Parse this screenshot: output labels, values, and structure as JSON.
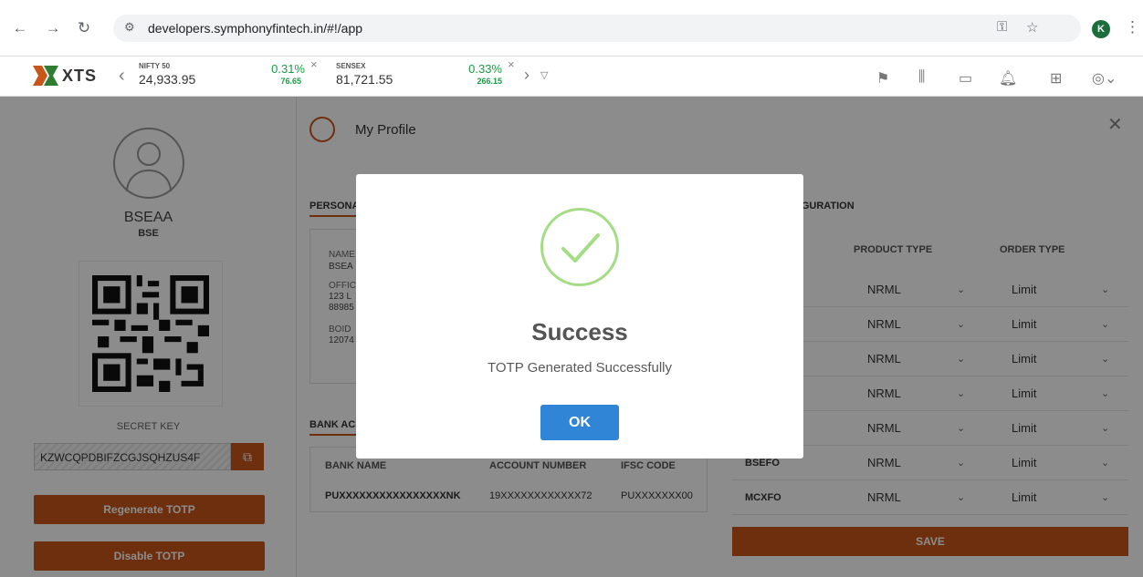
{
  "browser": {
    "url": "developers.symphonyfintech.in/#!/app",
    "profile_initial": "K"
  },
  "header": {
    "logo_text": "XTS",
    "indices": [
      {
        "name": "NIFTY 50",
        "value": "24,933.95",
        "pct": "0.31%",
        "change": "76.65"
      },
      {
        "name": "SENSEX",
        "value": "81,721.55",
        "pct": "0.33%",
        "change": "266.15"
      }
    ]
  },
  "left": {
    "user_name": "BSEAA",
    "user_sub": "BSE",
    "secret_label": "SECRET KEY",
    "secret_value": "KZWCQPDBIFZCGJSQHZUS4F",
    "regen_label": "Regenerate TOTP",
    "disable_label": "Disable TOTP"
  },
  "profile": {
    "title": "My Profile",
    "personal_tab": "PERSONA",
    "config_tab": "IFIGURATION",
    "personal_fields": [
      {
        "label": "NAME",
        "value": "BSEA"
      },
      {
        "label": "OFFIC",
        "value": "123 L"
      },
      {
        "label": "",
        "value": "88985"
      },
      {
        "label": "BOID",
        "value": "12074"
      }
    ],
    "bank_tab": "BANK AC",
    "bank_headers": [
      "BANK NAME",
      "ACCOUNT NUMBER",
      "IFSC CODE"
    ],
    "bank_row": [
      "PUXXXXXXXXXXXXXXXXNK",
      "19XXXXXXXXXXXX72",
      "PUXXXXXXX00"
    ],
    "config_headers": [
      "PRODUCT TYPE",
      "ORDER TYPE"
    ],
    "config_rows": [
      {
        "segment": "",
        "product": "NRML",
        "order": "Limit"
      },
      {
        "segment": "",
        "product": "NRML",
        "order": "Limit"
      },
      {
        "segment": "",
        "product": "NRML",
        "order": "Limit"
      },
      {
        "segment": "",
        "product": "NRML",
        "order": "Limit"
      },
      {
        "segment": "",
        "product": "NRML",
        "order": "Limit"
      },
      {
        "segment": "BSEFO",
        "product": "NRML",
        "order": "Limit"
      },
      {
        "segment": "MCXFO",
        "product": "NRML",
        "order": "Limit"
      }
    ],
    "save_label": "SAVE"
  },
  "modal": {
    "title": "Success",
    "message": "TOTP Generated Successfully",
    "ok_label": "OK"
  },
  "colors": {
    "accent": "#c8561b",
    "success_green": "#1b9a45",
    "ok_blue": "#3085d6"
  }
}
